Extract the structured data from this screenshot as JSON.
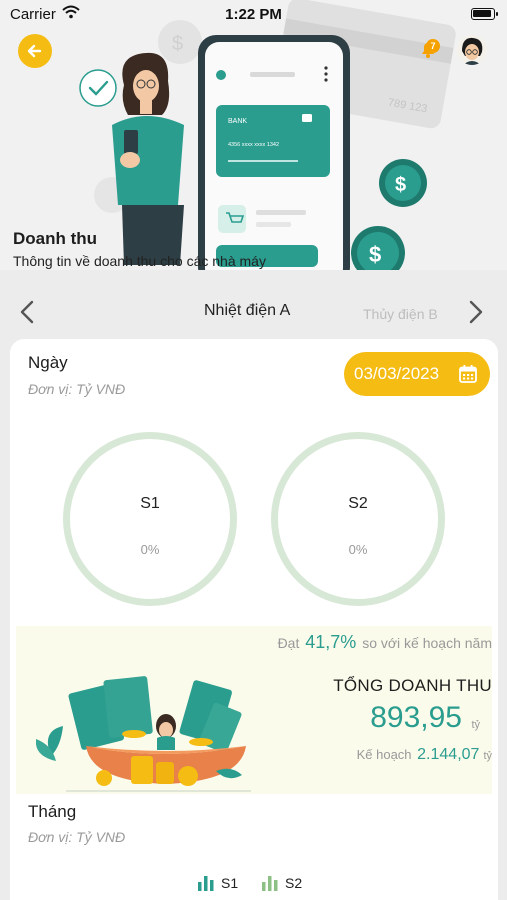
{
  "status": {
    "carrier": "Carrier",
    "time": "1:22 PM"
  },
  "header": {
    "title": "Doanh thu",
    "subtitle": "Thông tin về doanh thu cho các nhà máy",
    "notification_count": "7",
    "illustration": {
      "card_bank": "BANK",
      "card_number": "4356  xxxx  xxxx  1342",
      "bg_card_number": "789 123"
    }
  },
  "plant_nav": {
    "current": "Nhiệt điện A",
    "next": "Thủy điện B"
  },
  "daily": {
    "title": "Ngày",
    "unit": "Đơn vị: Tỷ VNĐ",
    "date": "03/03/2023",
    "gauges": [
      {
        "label": "S1",
        "percent": "0%"
      },
      {
        "label": "S2",
        "percent": "0%"
      }
    ]
  },
  "revenue": {
    "achieve_prefix": "Đạt",
    "achieve_pct": "41,7%",
    "achieve_suffix": "so với kế hoạch năm",
    "title": "TỔNG DOANH THU",
    "value": "893,95",
    "unit": "tỷ",
    "plan_label": "Kế hoạch",
    "plan_value": "2.144,07",
    "plan_unit": "tỷ"
  },
  "monthly": {
    "title": "Tháng",
    "unit": "Đơn vị: Tỷ VNĐ",
    "legend": [
      {
        "label": "S1",
        "color": "#2a9d8f"
      },
      {
        "label": "S2",
        "color": "#8cc084"
      }
    ]
  },
  "colors": {
    "accent": "#f5bc13",
    "teal": "#2a9d8f",
    "gauge_track": "#d8e8d6"
  }
}
